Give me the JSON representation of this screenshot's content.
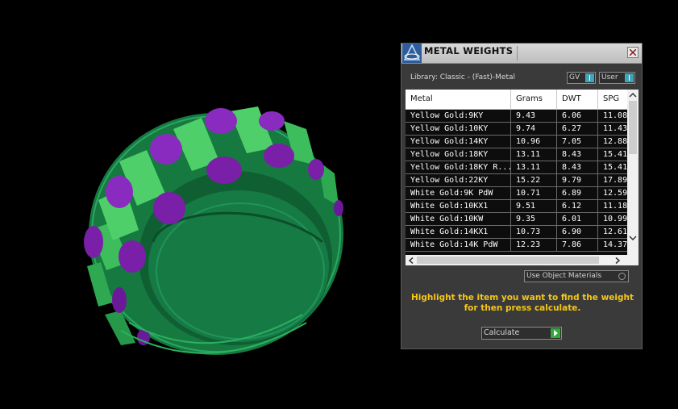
{
  "dialog": {
    "title": "METAL WEIGHTS",
    "app_icon": "rhino-matrix-logo-icon",
    "close_icon": "close-icon",
    "library_label": "Library: Classic - (Fast)-Metal",
    "toggles": [
      {
        "label": "GV",
        "on": true
      },
      {
        "label": "User",
        "on": true
      }
    ],
    "table": {
      "columns": [
        "Metal",
        "Grams",
        "DWT",
        "SPG"
      ],
      "rows": [
        {
          "metal": "Yellow Gold:9KY",
          "grams": "9.43",
          "dwt": "6.06",
          "spg": "11.08"
        },
        {
          "metal": "Yellow Gold:10KY",
          "grams": "9.74",
          "dwt": "6.27",
          "spg": "11.43"
        },
        {
          "metal": "Yellow Gold:14KY",
          "grams": "10.96",
          "dwt": "7.05",
          "spg": "12.88"
        },
        {
          "metal": "Yellow Gold:18KY",
          "grams": "13.11",
          "dwt": "8.43",
          "spg": "15.41"
        },
        {
          "metal": "Yellow Gold:18KY R...",
          "grams": "13.11",
          "dwt": "8.43",
          "spg": "15.41"
        },
        {
          "metal": "Yellow Gold:22KY",
          "grams": "15.22",
          "dwt": "9.79",
          "spg": "17.89"
        },
        {
          "metal": "White Gold:9K PdW",
          "grams": "10.71",
          "dwt": "6.89",
          "spg": "12.59"
        },
        {
          "metal": "White Gold:10KX1",
          "grams": "9.51",
          "dwt": "6.12",
          "spg": "11.18"
        },
        {
          "metal": "White Gold:10KW",
          "grams": "9.35",
          "dwt": "6.01",
          "spg": "10.99"
        },
        {
          "metal": "White Gold:14KX1",
          "grams": "10.73",
          "dwt": "6.90",
          "spg": "12.61"
        },
        {
          "metal": "White Gold:14K PdW",
          "grams": "12.23",
          "dwt": "7.86",
          "spg": "14.37"
        }
      ]
    },
    "use_object_materials_label": "Use Object Materials",
    "hint_text": "Highlight the item you want to find the weight for then press calculate.",
    "calculate_label": "Calculate"
  },
  "colors": {
    "ring_green": "#1f8a4e",
    "ring_light_green": "#3dbd5c",
    "gem_purple": "#7a1fa8",
    "hint_yellow": "#f5c617",
    "toggle_accent": "#3ea6b8",
    "calc_green": "#34a83a"
  }
}
